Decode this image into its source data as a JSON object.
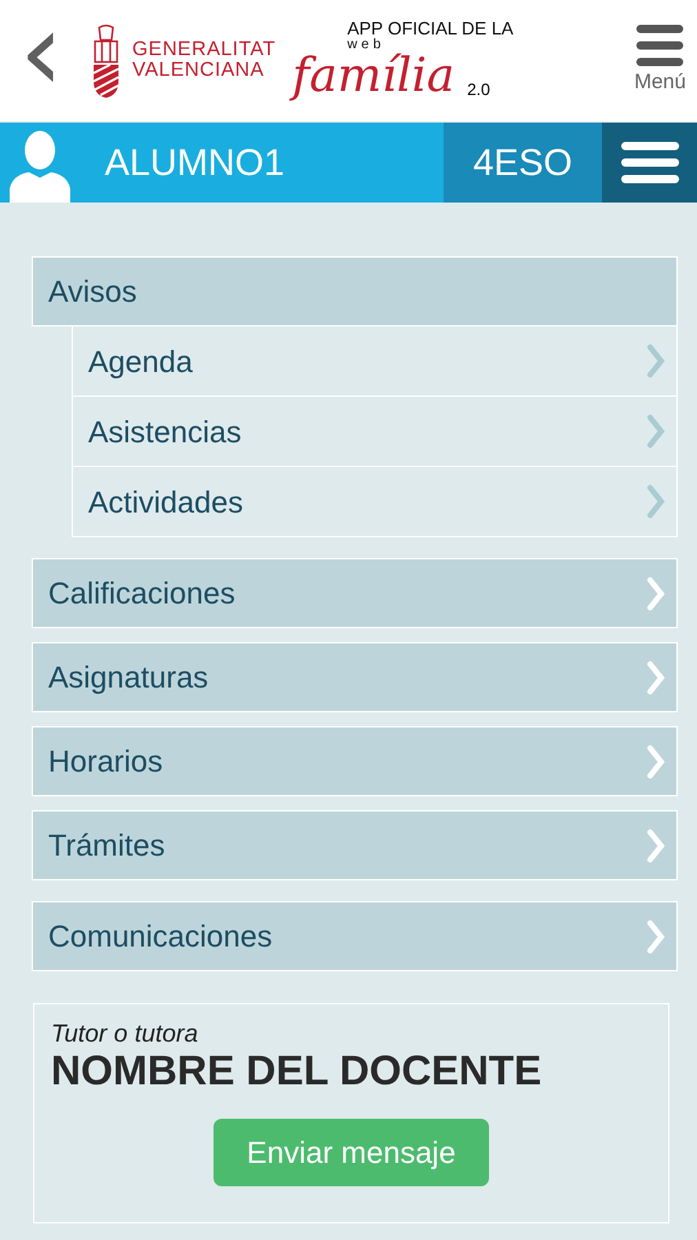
{
  "header": {
    "back": "‹",
    "org_name": [
      "GENERALITAT",
      "VALENCIANA"
    ],
    "app_tagline": "APP OFICIAL DE LA",
    "app_web": "web",
    "app_name": "família",
    "app_version": "2.0",
    "menu_label": "Menú"
  },
  "student": {
    "name": "ALUMNO1",
    "group": "4ESO"
  },
  "sections": [
    [
      {
        "label": "Avisos",
        "kind": "header",
        "children": [
          {
            "label": "Agenda"
          },
          {
            "label": "Asistencias"
          },
          {
            "label": "Actividades"
          }
        ]
      }
    ],
    [
      {
        "label": "Calificaciones",
        "kind": "link"
      },
      {
        "label": "Asignaturas",
        "kind": "link"
      },
      {
        "label": "Horarios",
        "kind": "link"
      },
      {
        "label": "Trámites",
        "kind": "link"
      }
    ],
    [
      {
        "label": "Comunicaciones",
        "kind": "link"
      }
    ]
  ],
  "tutor": {
    "caption": "Tutor o tutora",
    "name": "NOMBRE DEL DOCENTE",
    "button": "Enviar mensaje"
  }
}
